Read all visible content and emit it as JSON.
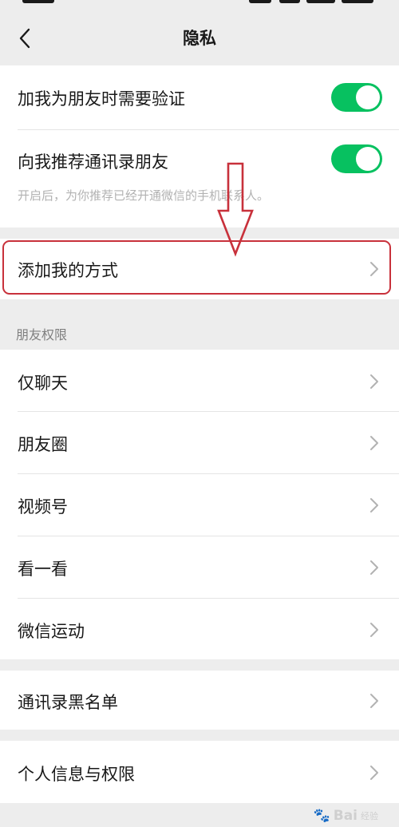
{
  "nav": {
    "title": "隐私"
  },
  "verification": {
    "add_friend_verify_label": "加我为朋友时需要验证",
    "add_friend_verify_on": true,
    "recommend_contacts_label": "向我推荐通讯录朋友",
    "recommend_contacts_on": true,
    "recommend_contacts_hint": "开启后，为你推荐已经开通微信的手机联系人。"
  },
  "ways_to_add": {
    "label": "添加我的方式"
  },
  "friend_permissions": {
    "header": "朋友权限",
    "items": [
      {
        "label": "仅聊天"
      },
      {
        "label": "朋友圈"
      },
      {
        "label": "视频号"
      },
      {
        "label": "看一看"
      },
      {
        "label": "微信运动"
      }
    ]
  },
  "blacklist": {
    "label": "通讯录黑名单"
  },
  "personal_info": {
    "label": "个人信息与权限"
  },
  "colors": {
    "toggle_on": "#07c160",
    "annotation_red": "#c8313b",
    "background": "#ededed"
  },
  "watermark": {
    "brand": "Bai",
    "sub": "经验"
  }
}
